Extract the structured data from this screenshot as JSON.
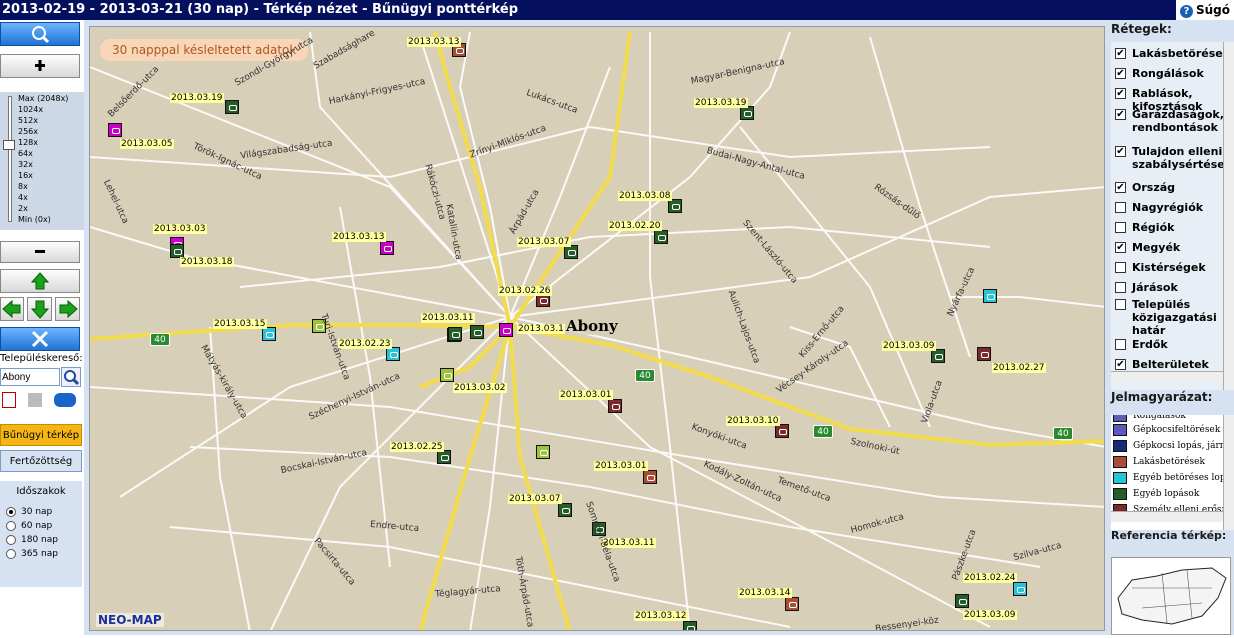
{
  "title": "2013-02-19 - 2013-03-21 (30 nap) - Térkép nézet - Bűnügyi ponttérkép",
  "help_label": "Súgó",
  "zoom": {
    "levels": [
      "Max (2048x)",
      "1024x",
      "512x",
      "256x",
      "128x",
      "64x",
      "32x",
      "16x",
      "8x",
      "4x",
      "2x",
      "Min (0x)"
    ]
  },
  "search": {
    "label": "Településkereső:",
    "value": "Abony"
  },
  "buttons": {
    "crime_map": "Bűnügyi térkép",
    "infection": "Fertőzöttség"
  },
  "period": {
    "title": "Időszakok",
    "options": [
      "30 nap",
      "60 nap",
      "180 nap",
      "365 nap"
    ],
    "selected": "30 nap"
  },
  "map": {
    "notice": "30 napppal késleltetett adatok",
    "brand": "NEO-MAP",
    "town": "Abony",
    "road_number": "40",
    "dates": [
      "2013.03.13",
      "2013.03.19",
      "2013.03.05",
      "2013.03.19",
      "2013.03.03",
      "2013.03.18",
      "2013.03.13",
      "2013.03.08",
      "2013.02.20",
      "2013.03.07",
      "2013.02.26",
      "2013.03.15",
      "2013.03.11",
      "2013.03.1",
      "2013.02.23",
      "2013.03.02",
      "2013.03.09",
      "2013.02.27",
      "2013.03.01",
      "2013.03.10",
      "2013.02.25",
      "2013.03.01",
      "2013.03.07",
      "2013.03.11",
      "2013.03.14",
      "2013.03.12",
      "2013.02.24",
      "2013.03.09"
    ],
    "streets": [
      "Szabadsághare",
      "Szondi-György-utca",
      "Belsőerdő-utca",
      "Harkányi-Frigyes-utca",
      "Magyar-Benigna-utca",
      "Lukács-utca",
      "Zrínyi-Miklós-utca",
      "Török-Ignác-utca",
      "Világszabadság-utca",
      "Rákóczi-utca",
      "Budai-Nagy-Antal-utca",
      "Rózsás-dűlő",
      "Lehel-utca",
      "Árpád-utca",
      "Kataliin-utca",
      "Szent-László-utca",
      "Nyárfa-utca",
      "Turi-István-utca",
      "Aulich-Lajos-utca",
      "Kiss-Ernő-utca",
      "Mátyás-király-utca",
      "Széchenyi-István-utca",
      "Vécsey-Károly-utca",
      "Viola-utca",
      "Szolnoki-út",
      "Konyóki-utca",
      "Kodály-Zoltán-utca",
      "Temető-utca",
      "Homok-utca",
      "Bocskai-István-utca",
      "Endre-utca",
      "Somogyi-Béla-utca",
      "Szilva-utca",
      "Téglagyár-utca",
      "Pacsirta-utca",
      "Pászke-utca",
      "Tóth-Árpád-utca",
      "Bessenyei-köz"
    ]
  },
  "layers": {
    "title": "Rétegek:",
    "items": [
      {
        "label": "Lakásbetörések",
        "checked": true
      },
      {
        "label": "Rongálások",
        "checked": true
      },
      {
        "label": "Rablások, kifosztások",
        "checked": true
      },
      {
        "label": "Garázdaságok, rendbontások",
        "checked": true
      },
      {
        "label": "Tulajdon elleni szabálysértések",
        "checked": true
      },
      {
        "label": "Ország",
        "checked": true
      },
      {
        "label": "Nagyrégiók",
        "checked": false
      },
      {
        "label": "Régiók",
        "checked": false
      },
      {
        "label": "Megyék",
        "checked": true
      },
      {
        "label": "Kistérségek",
        "checked": false
      },
      {
        "label": "Járások",
        "checked": false
      },
      {
        "label": "Település közigazgatási határ",
        "checked": false
      },
      {
        "label": "Erdők",
        "checked": false
      },
      {
        "label": "Belterületek",
        "checked": true
      }
    ]
  },
  "legend": {
    "title": "Jelmagyarázat:",
    "items": [
      {
        "label": "Rongálások",
        "color": "#5a5ab8"
      },
      {
        "label": "Gépkocsifeltörések",
        "color": "#5a5ab8"
      },
      {
        "label": "Gépkocsi lopás, jármű",
        "color": "#1a2a7a"
      },
      {
        "label": "Lakásbetörések",
        "color": "#a84f33"
      },
      {
        "label": "Egyéb betöréses lopás",
        "color": "#27c3d8"
      },
      {
        "label": "Egyéb lopások",
        "color": "#255d28"
      },
      {
        "label": "Személy elleni erőszak",
        "color": "#7a2a2a"
      }
    ]
  },
  "refmap_title": "Referencia térkép:"
}
